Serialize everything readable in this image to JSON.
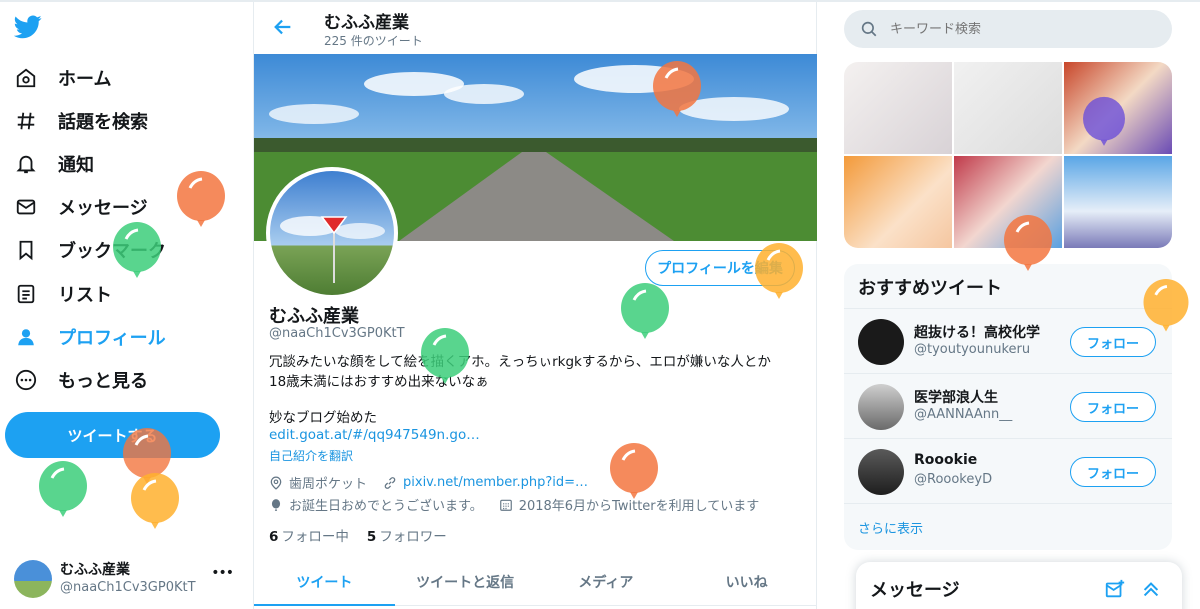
{
  "nav": {
    "items": [
      {
        "label": "ホーム",
        "icon": "home-icon"
      },
      {
        "label": "話題を検索",
        "icon": "hashtag-icon"
      },
      {
        "label": "通知",
        "icon": "bell-icon"
      },
      {
        "label": "メッセージ",
        "icon": "mail-icon"
      },
      {
        "label": "ブックマーク",
        "icon": "bookmark-icon"
      },
      {
        "label": "リスト",
        "icon": "list-icon"
      },
      {
        "label": "プロフィール",
        "icon": "person-icon"
      },
      {
        "label": "もっと見る",
        "icon": "more-circle-icon"
      }
    ],
    "tweet_button": "ツイートする",
    "account": {
      "name": "むふふ産業",
      "handle": "@naaCh1Cv3GP0KtT",
      "more": "•••"
    }
  },
  "profile": {
    "header_title": "むふふ産業",
    "tweet_count": "225 件のツイート",
    "edit_button": "プロフィールを編集",
    "name": "むふふ産業",
    "handle": "@naaCh1Cv3GP0KtT",
    "bio_line1": "冗談みたいな顔をして絵を描くアホ。えっちぃrkgkするから、エロが嫌いな人とか",
    "bio_line2": "18歳未満にはおすすめ出来ないなぁ",
    "bio_line3": "妙なブログ始めた",
    "bio_link": "edit.goat.at/#/qq947549n.go…",
    "translate": "自己紹介を翻訳",
    "location": "歯周ポケット",
    "website": "pixiv.net/member.php?id=…",
    "birthday": "お誕生日おめでとうございます。",
    "joined": "2018年6月からTwitterを利用しています",
    "following_count": "6",
    "following_label": "フォロー中",
    "followers_count": "5",
    "followers_label": "フォロワー",
    "tabs": [
      "ツイート",
      "ツイートと返信",
      "メディア",
      "いいね"
    ]
  },
  "search": {
    "placeholder": "キーワード検索"
  },
  "recommended": {
    "title": "おすすめツイート",
    "users": [
      {
        "name": "超抜ける！高校化学",
        "handle": "@tyoutyounukeru",
        "button": "フォロー"
      },
      {
        "name": "医学部浪人生",
        "handle": "@AANNAAnn__",
        "button": "フォロー"
      },
      {
        "name": "Roookie",
        "handle": "@RoookeyD",
        "button": "フォロー"
      }
    ],
    "show_more": "さらに表示"
  },
  "messages": {
    "title": "メッセージ"
  },
  "colors": {
    "accent": "#1da1f2",
    "balloon_orange": "#f08a5d",
    "balloon_green": "#4cd384",
    "balloon_yellow": "#ffb83f"
  }
}
